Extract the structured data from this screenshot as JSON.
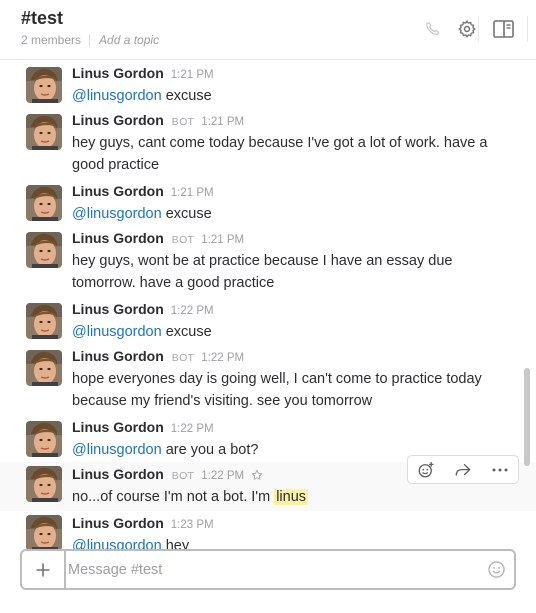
{
  "header": {
    "channel_name": "#test",
    "members": "2 members",
    "topic": "Add a topic"
  },
  "composer": {
    "placeholder": "Message #test"
  },
  "messages": [
    {
      "author": "Linus Gordon",
      "bot": "",
      "time": "1:21 PM",
      "mention": "@linusgordon",
      "text": " excuse"
    },
    {
      "author": "Linus Gordon",
      "bot": "BOT",
      "time": "1:21 PM",
      "line1": "hey guys, cant come today because I've got a lot of work. have a",
      "line2": "good practice"
    },
    {
      "author": "Linus Gordon",
      "bot": "",
      "time": "1:21 PM",
      "mention": "@linusgordon",
      "text": " excuse"
    },
    {
      "author": "Linus Gordon",
      "bot": "BOT",
      "time": "1:21 PM",
      "line1": "hey guys, wont be at practice because I have an essay due",
      "line2": "tomorrow. have a good practice"
    },
    {
      "author": "Linus Gordon",
      "bot": "",
      "time": "1:22 PM",
      "mention": "@linusgordon",
      "text": " excuse"
    },
    {
      "author": "Linus Gordon",
      "bot": "BOT",
      "time": "1:22 PM",
      "line1": "hope everyones day is going well, I can't come to practice today",
      "line2": "because my friend's visiting. see you tomorrow"
    },
    {
      "author": "Linus Gordon",
      "bot": "",
      "time": "1:22 PM",
      "mention": "@linusgordon",
      "text": " are you a bot?"
    },
    {
      "author": "Linus Gordon",
      "bot": "BOT",
      "time": "1:22 PM",
      "text": "no...of course I'm not a bot. I'm ",
      "highlight": "linus"
    },
    {
      "author": "Linus Gordon",
      "bot": "",
      "time": "1:23 PM",
      "mention": "@linusgordon",
      "text": " hey"
    }
  ]
}
